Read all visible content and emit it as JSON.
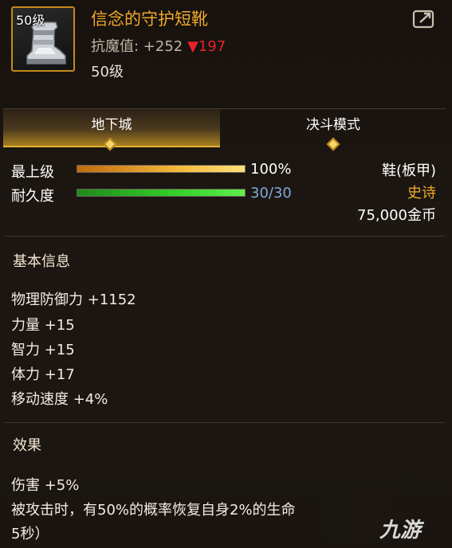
{
  "header": {
    "icon_level": "50级",
    "item_name": "信念的守护短靴",
    "magic_resist_label": "抗魔值: +252",
    "magic_resist_down": "▼197",
    "level": "50级"
  },
  "tabs": [
    {
      "label": "地下城",
      "active": true
    },
    {
      "label": "决斗模式",
      "active": false
    }
  ],
  "bars": {
    "max_level": {
      "label": "最上级",
      "value_text": "100%",
      "fraction": 1.0
    },
    "durability": {
      "label": "耐久度",
      "value_text": "30/30",
      "fraction": 1.0
    }
  },
  "item_info": {
    "type": "鞋(板甲)",
    "rarity": "史诗",
    "price": "75,000金币"
  },
  "basic_info": {
    "title": "基本信息",
    "stats": [
      "物理防御力 +1152",
      "力量 +15",
      "智力 +15",
      "体力 +17",
      "移动速度 +4%"
    ]
  },
  "effect": {
    "title": "效果",
    "lines": [
      "伤害 +5%",
      "被攻击时，有50%的概率恢复自身2%的生命",
      "5秒）"
    ]
  },
  "watermark": "九游",
  "colors": {
    "item_name": "#f0a92a",
    "rarity": "#f0a92a",
    "durability_text": "#7fa9d9",
    "down_arrow": "#e8222a"
  }
}
